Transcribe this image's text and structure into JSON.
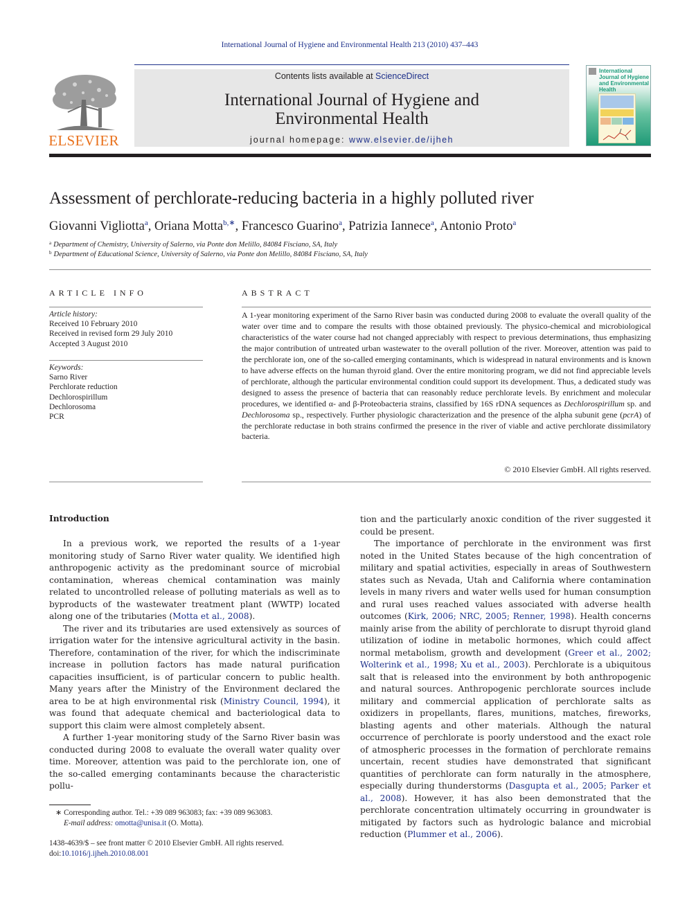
{
  "running_head": "International Journal of Hygiene and Environmental Health 213 (2010) 437–443",
  "masthead": {
    "contents_prefix": "Contents lists available at ",
    "contents_link": "ScienceDirect",
    "journal_title_line1": "International Journal of Hygiene and",
    "journal_title_line2": "Environmental Health",
    "homepage_prefix": "journal homepage: ",
    "homepage_link": "www.elsevier.de/ijheh",
    "publisher_logo_text": "ELSEVIER",
    "cover_title": "International Journal of Hygiene and Environmental Health"
  },
  "article": {
    "title": "Assessment of perchlorate-reducing bacteria in a highly polluted river",
    "authors": [
      {
        "name": "Giovanni Vigliotta",
        "sup": "a",
        "sep": ", "
      },
      {
        "name": "Oriana Motta",
        "sup": "b,∗",
        "sep": ", "
      },
      {
        "name": "Francesco Guarino",
        "sup": "a",
        "sep": ", "
      },
      {
        "name": "Patrizia Iannece",
        "sup": "a",
        "sep": ", "
      },
      {
        "name": "Antonio Proto",
        "sup": "a",
        "sep": ""
      }
    ],
    "affiliations": [
      {
        "mark": "a",
        "text": "Department of Chemistry, University of Salerno, via Ponte don Melillo, 84084 Fisciano, SA, Italy"
      },
      {
        "mark": "b",
        "text": "Department of Educational Science, University of Salerno, via Ponte don Melillo, 84084 Fisciano, SA, Italy"
      }
    ]
  },
  "article_info": {
    "heading": "ARTICLE INFO",
    "history_label": "Article history:",
    "history": [
      "Received 10 February 2010",
      "Received in revised form 29 July 2010",
      "Accepted 3 August 2010"
    ],
    "keywords_label": "Keywords:",
    "keywords": [
      "Sarno River",
      "Perchlorate reduction",
      "Dechlorospirillum",
      "Dechlorosoma",
      "PCR"
    ]
  },
  "abstract": {
    "heading": "ABSTRACT",
    "parts": [
      "A 1-year monitoring experiment of the Sarno River basin was conducted during 2008 to evaluate the overall quality of the water over time and to compare the results with those obtained previously. The physico-chemical and microbiological characteristics of the water course had not changed appreciably with respect to previous determinations, thus emphasizing the major contribution of untreated urban wastewater to the overall pollution of the river. Moreover, attention was paid to the perchlorate ion, one of the so-called emerging contaminants, which is widespread in natural environments and is known to have adverse effects on the human thyroid gland. Over the entire monitoring program, we did not find appreciable levels of perchlorate, although the particular environmental condition could support its development. Thus, a dedicated study was designed to assess the presence of bacteria that can reasonably reduce perchlorate levels. By enrichment and molecular procedures, we identified α- and β-Proteobacteria strains, classified by 16S rDNA sequences as ",
      "Dechlorospirillum",
      " sp. and ",
      "Dechlorosoma",
      " sp., respectively. Further physiologic characterization and the presence of the alpha subunit gene (",
      "pcrA",
      ") of the perchlorate reductase in both strains confirmed the presence in the river of viable and active perchlorate dissimilatory bacteria."
    ],
    "copyright": "© 2010 Elsevier GmbH. All rights reserved."
  },
  "body": {
    "intro_heading": "Introduction",
    "left_column": [
      {
        "pre": "In a previous work, we reported the results of a 1-year monitoring study of Sarno River water quality. We identified high anthropogenic activity as the predominant source of microbial contamination, whereas chemical contamination was mainly related to uncontrolled release of polluting materials as well as to byproducts of the wastewater treatment plant (WWTP) located along one of the tributaries (",
        "cite": "Motta et al., 2008",
        "post": ")."
      },
      {
        "pre": "The river and its tributaries are used extensively as sources of irrigation water for the intensive agricultural activity in the basin. Therefore, contamination of the river, for which the indiscriminate increase in pollution factors has made natural purification capacities insufficient, is of particular concern to public health. Many years after the Ministry of the Environment declared the area to be at high environmental risk (",
        "cite": "Ministry Council, 1994",
        "post": "), it was found that adequate chemical and bacteriological data to support this claim were almost completely absent."
      },
      {
        "pre": "A further 1-year monitoring study of the Sarno River basin was conducted during 2008 to evaluate the overall water quality over time. Moreover, attention was paid to the perchlorate ion, one of the so-called emerging contaminants because the characteristic pollu-",
        "cite": "",
        "post": ""
      }
    ],
    "right_column": {
      "continuation": "tion and the particularly anoxic condition of the river suggested it could be present.",
      "p1_a": "The importance of perchlorate in the environment was first noted in the United States because of the high concentration of military and spatial activities, especially in areas of Southwestern states such as Nevada, Utah and California where contamination levels in many rivers and water wells used for human consumption and rural uses reached values associated with adverse health outcomes (",
      "cite1": "Kirk, 2006; NRC, 2005; Renner, 1998",
      "p1_b": "). Health concerns mainly arise from the ability of perchlorate to disrupt thyroid gland utilization of iodine in metabolic hormones, which could affect normal metabolism, growth and development (",
      "cite2": "Greer et al., 2002; Wolterink et al., 1998; Xu et al., 2003",
      "p1_c": "). Perchlorate is a ubiquitous salt that is released into the environment by both anthropogenic and natural sources. Anthropogenic perchlorate sources include military and commercial application of perchlorate salts as oxidizers in propellants, flares, munitions, matches, fireworks, blasting agents and other materials. Although the natural occurrence of perchlorate is poorly understood and the exact role of atmospheric processes in the formation of perchlorate remains uncertain, recent studies have demonstrated that significant quantities of perchlorate can form naturally in the atmosphere, especially during thunderstorms (",
      "cite3": "Dasgupta et al., 2005; Parker et al., 2008",
      "p1_d": "). However, it has also been demonstrated that the perchlorate concentration ultimately occurring in groundwater is mitigated by factors such as hydrologic balance and microbial reduction (",
      "cite4": "Plummer et al., 2006",
      "p1_e": ")."
    }
  },
  "footnotes": {
    "corresponding": "∗  Corresponding author. Tel.: +39 089 963083; fax: +39 089 963083.",
    "email_label": "E-mail address:",
    "email": "omotta@unisa.it",
    "email_suffix": " (O. Motta).",
    "front_matter": "1438-4639/$ – see front matter © 2010 Elsevier GmbH. All rights reserved.",
    "doi_prefix": "doi:",
    "doi": "10.1016/j.ijheh.2010.08.001"
  }
}
